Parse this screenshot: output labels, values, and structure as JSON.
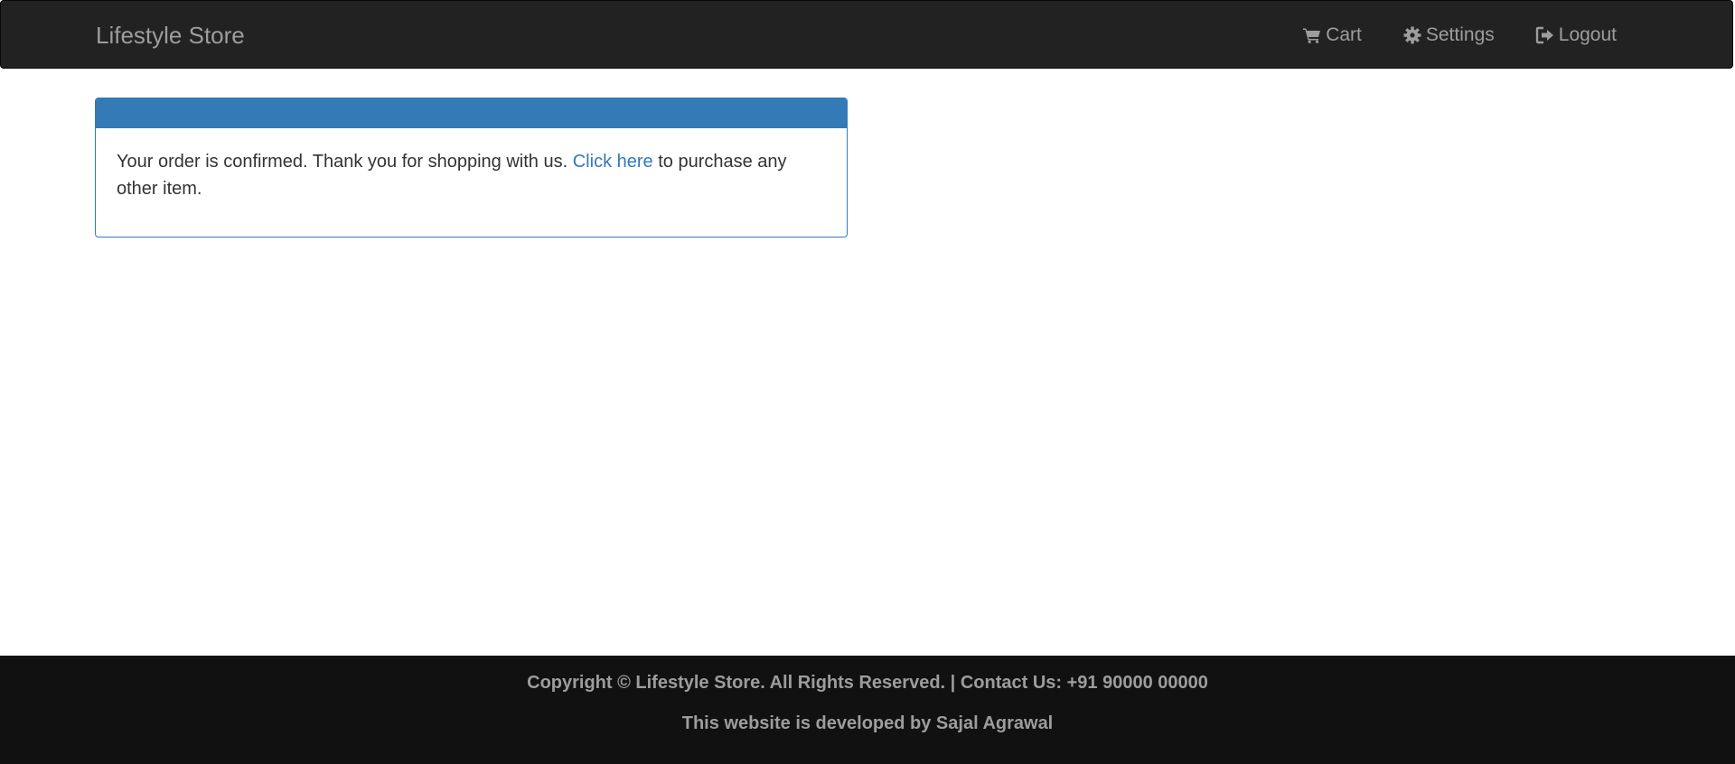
{
  "navbar": {
    "brand": "Lifestyle Store",
    "links": [
      {
        "label": "Cart",
        "icon": "cart-icon"
      },
      {
        "label": "Settings",
        "icon": "gear-icon"
      },
      {
        "label": "Logout",
        "icon": "logout-icon"
      }
    ]
  },
  "panel": {
    "message_prefix": "Your order is confirmed. Thank you for shopping with us.",
    "link_text": "Click here",
    "message_suffix": "to purchase any other item."
  },
  "footer": {
    "copyright": "Copyright © Lifestyle Store. All Rights Reserved. | Contact Us: +91 90000 00000",
    "developer": "This website is developed by Sajal Agrawal"
  },
  "colors": {
    "navbar_bg": "#222222",
    "nav_text": "#9d9d9d",
    "panel_primary": "#337ab7",
    "footer_bg": "#111111"
  }
}
